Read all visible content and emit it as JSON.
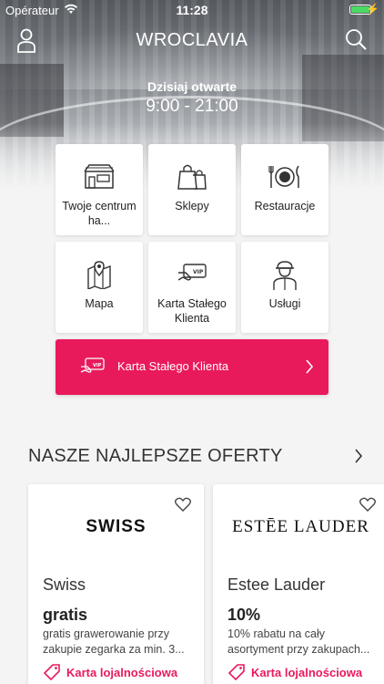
{
  "status_bar": {
    "carrier": "Opérateur",
    "time": "11:28"
  },
  "header": {
    "title": "WROCLAVIA",
    "open_label": "Dzisiaj otwarte",
    "open_hours": "9:00 - 21:00"
  },
  "tiles": [
    {
      "label": "Twoje centrum ha...",
      "icon": "mall-icon"
    },
    {
      "label": "Sklepy",
      "icon": "shopping-bags-icon"
    },
    {
      "label": "Restauracje",
      "icon": "restaurant-icon"
    },
    {
      "label": "Mapa",
      "icon": "map-icon"
    },
    {
      "label": "Karta Stałego Klienta",
      "icon": "vip-card-icon"
    },
    {
      "label": "Usługi",
      "icon": "service-person-icon"
    }
  ],
  "banner": {
    "label": "Karta Stałego Klienta",
    "card_text": "VIP"
  },
  "offers": {
    "title": "NASZE NAJLEPSZE OFERTY",
    "items": [
      {
        "logo": "SWISS",
        "name": "Swiss",
        "deal": "gratis",
        "description": "gratis grawerowanie przy zakupie zegarka za min. 3...",
        "tag": "Karta lojalnościowa"
      },
      {
        "logo": "ESTĒE LAUDER",
        "name": "Estee Lauder",
        "deal": "10%",
        "description": "10% rabatu na cały asortyment przy zakupach...",
        "tag": "Karta lojalnościowa"
      }
    ]
  },
  "colors": {
    "accent": "#e91a5c"
  }
}
